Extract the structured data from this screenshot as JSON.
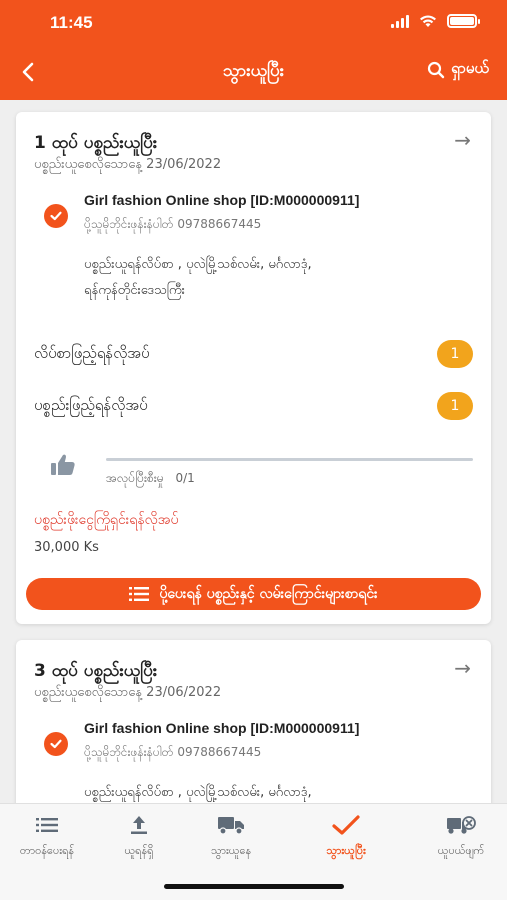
{
  "status_bar": {
    "time": "11:45"
  },
  "header": {
    "title": "သွားယူပြီး",
    "search_label": "ရှာမယ်"
  },
  "orders": [
    {
      "title": "1 ထုပ် ပစ္စည်းယူပြီး",
      "date_label": "ပစ္စည်းယူစေလိုသောနေ့",
      "date": "23/06/2022",
      "shop_name": "Girl fashion Online shop [ID:M000000911]",
      "phone_label": "ပို့သူမိုဘိုင်းဖုန်းနံပါတ်",
      "phone": "09788667445",
      "address_line1": "ပစ္စည်းယူရန်လိပ်စာ , ပုလဲမြို့သစ်လမ်း, မင်္ဂလာဒုံ,",
      "address_line2": "ရန်ကုန်တိုင်းဒေသကြီး",
      "address_fill_label": "လိပ်စာဖြည့်ရန်လိုအပ်",
      "address_fill_count": "1",
      "item_fill_label": "ပစ္စည်းဖြည့်ရန်လိုအပ်",
      "item_fill_count": "1",
      "progress_label": "အလုပ်ပြီးစီးမှု",
      "progress_count": "0/1",
      "progress_fraction": 0,
      "warning": "ပစ္စည်းဖိုးငွေကြိုရှင်းရန်လိုအပ်",
      "amount": "30,000 Ks",
      "action_label": "ပို့ပေးရန် ပစ္စည်းနှင့် လမ်းကြောင်းများစာရင်း"
    },
    {
      "title": "3 ထုပ် ပစ္စည်းယူပြီး",
      "date_label": "ပစ္စည်းယူစေလိုသောနေ့",
      "date": "23/06/2022",
      "shop_name": "Girl fashion Online shop [ID:M000000911]",
      "phone_label": "ပို့သူမိုဘိုင်းဖုန်းနံပါတ်",
      "phone": "09788667445",
      "address_line1": "ပစ္စည်းယူရန်လိပ်စာ , ပုလဲမြို့သစ်လမ်း, မင်္ဂလာဒုံ,"
    }
  ],
  "bottom_nav": [
    {
      "label": "တာဝန်ပေးရန်",
      "icon": "list-icon"
    },
    {
      "label": "ယူရန်ရှိ",
      "icon": "upload-icon"
    },
    {
      "label": "သွားယူနေ",
      "icon": "truck-icon"
    },
    {
      "label": "သွားယူပြီး",
      "icon": "check-icon",
      "active": true
    },
    {
      "label": "ယူပယ်ဖျက်",
      "icon": "truck-cancel-icon"
    }
  ],
  "colors": {
    "brand": "#f2531c",
    "badge": "#f2a41c",
    "warning": "#e03a2c"
  }
}
